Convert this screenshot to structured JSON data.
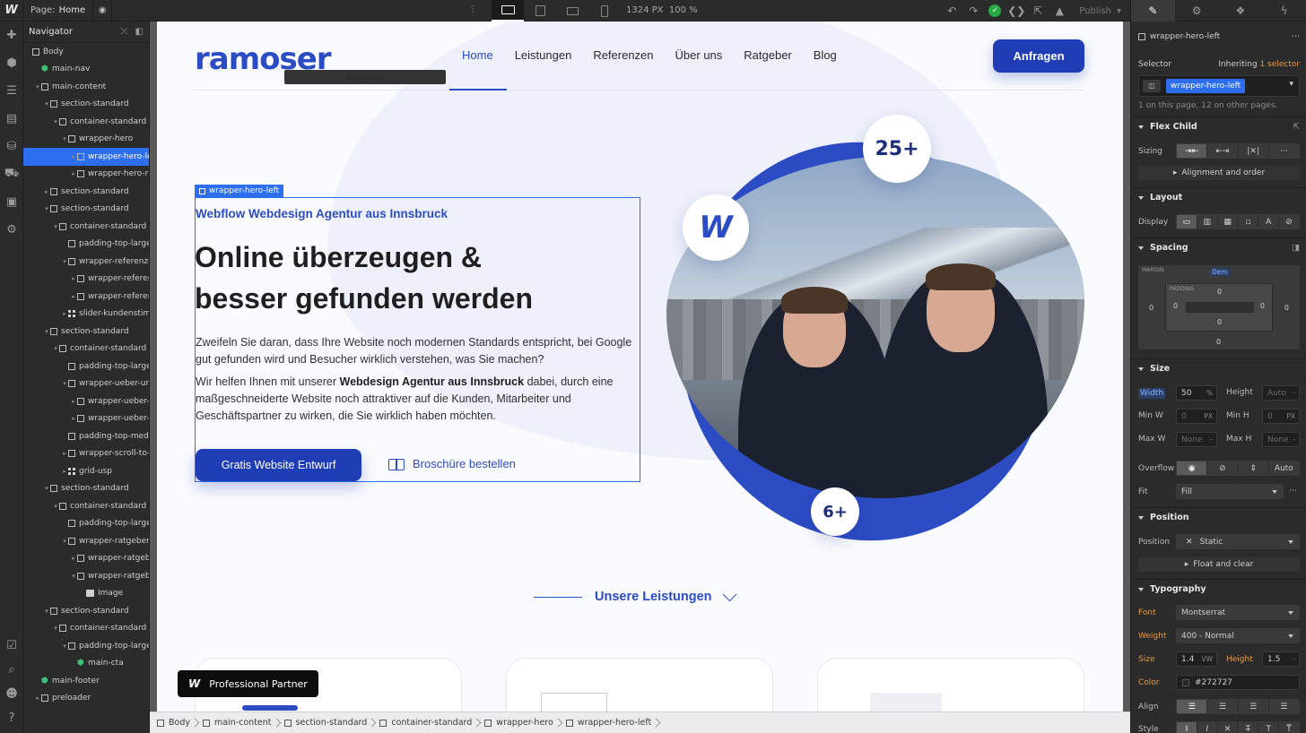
{
  "topbar": {
    "logo": "W",
    "page_label": "Page:",
    "page_name": "Home",
    "canvas_width": "1324",
    "canvas_unit": "PX",
    "zoom": "100 %",
    "publish": "Publish"
  },
  "navigator": {
    "title": "Navigator",
    "items": [
      {
        "label": "Body",
        "depth": 0,
        "icon": "box",
        "toggle": ""
      },
      {
        "label": "main-nav",
        "depth": 1,
        "icon": "symbol",
        "toggle": ""
      },
      {
        "label": "main-content",
        "depth": 1,
        "icon": "box",
        "toggle": "open"
      },
      {
        "label": "section-standard",
        "depth": 2,
        "icon": "box",
        "toggle": "open"
      },
      {
        "label": "container-standard",
        "depth": 3,
        "icon": "box",
        "toggle": "open"
      },
      {
        "label": "wrapper-hero",
        "depth": 4,
        "icon": "box",
        "toggle": "open"
      },
      {
        "label": "wrapper-hero-left",
        "depth": 5,
        "icon": "box",
        "toggle": "closed",
        "selected": true
      },
      {
        "label": "wrapper-hero-right",
        "depth": 5,
        "icon": "box",
        "toggle": "closed"
      },
      {
        "label": "section-standard",
        "depth": 2,
        "icon": "box",
        "toggle": "closed"
      },
      {
        "label": "section-standard",
        "depth": 2,
        "icon": "box",
        "toggle": "open"
      },
      {
        "label": "container-standard",
        "depth": 3,
        "icon": "box",
        "toggle": "open"
      },
      {
        "label": "padding-top-large",
        "depth": 4,
        "icon": "box",
        "toggle": ""
      },
      {
        "label": "wrapper-referenzen",
        "depth": 4,
        "icon": "box",
        "toggle": "open"
      },
      {
        "label": "wrapper-referenzen",
        "depth": 5,
        "icon": "box",
        "toggle": "closed"
      },
      {
        "label": "wrapper-referenzen",
        "depth": 5,
        "icon": "box",
        "toggle": "closed"
      },
      {
        "label": "slider-kundenstimmen",
        "depth": 4,
        "icon": "grid",
        "toggle": "closed"
      },
      {
        "label": "section-standard",
        "depth": 2,
        "icon": "box",
        "toggle": "open"
      },
      {
        "label": "container-standard",
        "depth": 3,
        "icon": "box",
        "toggle": "open"
      },
      {
        "label": "padding-top-large",
        "depth": 4,
        "icon": "box",
        "toggle": ""
      },
      {
        "label": "wrapper-ueber-uns",
        "depth": 4,
        "icon": "box",
        "toggle": "open"
      },
      {
        "label": "wrapper-ueber-uns",
        "depth": 5,
        "icon": "box",
        "toggle": "closed"
      },
      {
        "label": "wrapper-ueber-uns",
        "depth": 5,
        "icon": "box",
        "toggle": "closed"
      },
      {
        "label": "padding-top-medium",
        "depth": 4,
        "icon": "box",
        "toggle": ""
      },
      {
        "label": "wrapper-scroll-to-us",
        "depth": 4,
        "icon": "box",
        "toggle": "closed"
      },
      {
        "label": "grid-usp",
        "depth": 4,
        "icon": "grid",
        "toggle": "closed"
      },
      {
        "label": "section-standard",
        "depth": 2,
        "icon": "box",
        "toggle": "open"
      },
      {
        "label": "container-standard",
        "depth": 3,
        "icon": "box",
        "toggle": "open"
      },
      {
        "label": "padding-top-large",
        "depth": 4,
        "icon": "box",
        "toggle": ""
      },
      {
        "label": "wrapper-ratgeber-main",
        "depth": 4,
        "icon": "box",
        "toggle": "open"
      },
      {
        "label": "wrapper-ratgeber",
        "depth": 5,
        "icon": "box",
        "toggle": "closed"
      },
      {
        "label": "wrapper-ratgeber",
        "depth": 5,
        "icon": "box",
        "toggle": "open"
      },
      {
        "label": "Image",
        "depth": 6,
        "icon": "image",
        "toggle": ""
      },
      {
        "label": "section-standard",
        "depth": 2,
        "icon": "box",
        "toggle": "open"
      },
      {
        "label": "container-standard",
        "depth": 3,
        "icon": "box",
        "toggle": "open"
      },
      {
        "label": "padding-top-large",
        "depth": 4,
        "icon": "box",
        "toggle": "open"
      },
      {
        "label": "main-cta",
        "depth": 5,
        "icon": "symbol",
        "toggle": ""
      },
      {
        "label": "main-footer",
        "depth": 1,
        "icon": "symbol",
        "toggle": ""
      },
      {
        "label": "preloader",
        "depth": 1,
        "icon": "box",
        "toggle": "closed"
      }
    ]
  },
  "site": {
    "logo_text": "ramoser",
    "logo_sub": "webdesign",
    "nav": [
      "Home",
      "Leistungen",
      "Referenzen",
      "Über uns",
      "Ratgeber",
      "Blog"
    ],
    "cta": "Anfragen",
    "selected_tag": "wrapper-hero-left",
    "eyebrow": "Webflow Webdesign Agentur aus Innsbruck",
    "title_line1": "Online überzeugen &",
    "title_line2": "besser gefunden werden",
    "p1": "Zweifeln Sie daran, dass Ihre Website noch modernen Standards entspricht, bei Google gut gefunden wird und Besucher wirklich verstehen, was Sie machen?",
    "p2_a": "Wir helfen Ihnen mit unserer ",
    "p2_b": "Webdesign Agentur aus Innsbruck",
    "p2_c": " dabei, durch eine maßgeschneiderte Website noch attraktiver auf die Kunden, Mitarbeiter und Geschäftspartner zu wirken, die Sie wirklich haben möchten.",
    "btn_primary": "Gratis Website Entwurf",
    "btn_secondary": "Broschüre bestellen",
    "badge_top": "25+",
    "badge_w": "W",
    "badge_bottom": "6+",
    "section_heading": "Unsere Leistungen",
    "partner_badge": "Professional Partner",
    "partner_logo": "W"
  },
  "breadcrumb": [
    "Body",
    "main-content",
    "section-standard",
    "container-standard",
    "wrapper-hero",
    "wrapper-hero-left"
  ],
  "panel": {
    "element_name": "wrapper-hero-left",
    "selector_label": "Selector",
    "inheriting": "Inheriting",
    "inheriting_count": "1 selector",
    "selector_chip": "wrapper-hero-left",
    "selector_note": "1 on this page, 12 on other pages.",
    "flex_child": "Flex Child",
    "sizing": "Sizing",
    "alignment_order": "Alignment and order",
    "layout": "Layout",
    "display": "Display",
    "spacing": "Spacing",
    "margin_label": "MARGIN",
    "margin_top": "0em",
    "margin_left": "0",
    "margin_right": "0",
    "margin_bottom": "0",
    "padding_label": "PADDING",
    "padding_top": "0",
    "padding_left": "0",
    "padding_right": "0",
    "padding_bottom": "0",
    "size": "Size",
    "width_label": "Width",
    "width_value": "50",
    "width_unit": "%",
    "height_label": "Height",
    "height_value": "Auto",
    "minw_label": "Min W",
    "minw_value": "0",
    "minh_label": "Min H",
    "minh_value": "0",
    "px": "PX",
    "maxw_label": "Max W",
    "maxw_value": "None",
    "maxh_label": "Max H",
    "maxh_value": "None",
    "overflow_label": "Overflow",
    "overflow_auto": "Auto",
    "fit_label": "Fit",
    "fit_value": "Fill",
    "position": "Position",
    "position_label": "Position",
    "position_value": "Static",
    "float_clear": "Float and clear",
    "typography": "Typography",
    "font_label": "Font",
    "font_value": "Montserrat",
    "weight_label": "Weight",
    "weight_value": "400 - Normal",
    "size_label": "Size",
    "size_value": "1.4",
    "size_unit": "VW",
    "lineheight_label": "Height",
    "lineheight_value": "1.5",
    "color_label": "Color",
    "color_value": "#272727",
    "align_label": "Align",
    "style_label": "Style"
  }
}
